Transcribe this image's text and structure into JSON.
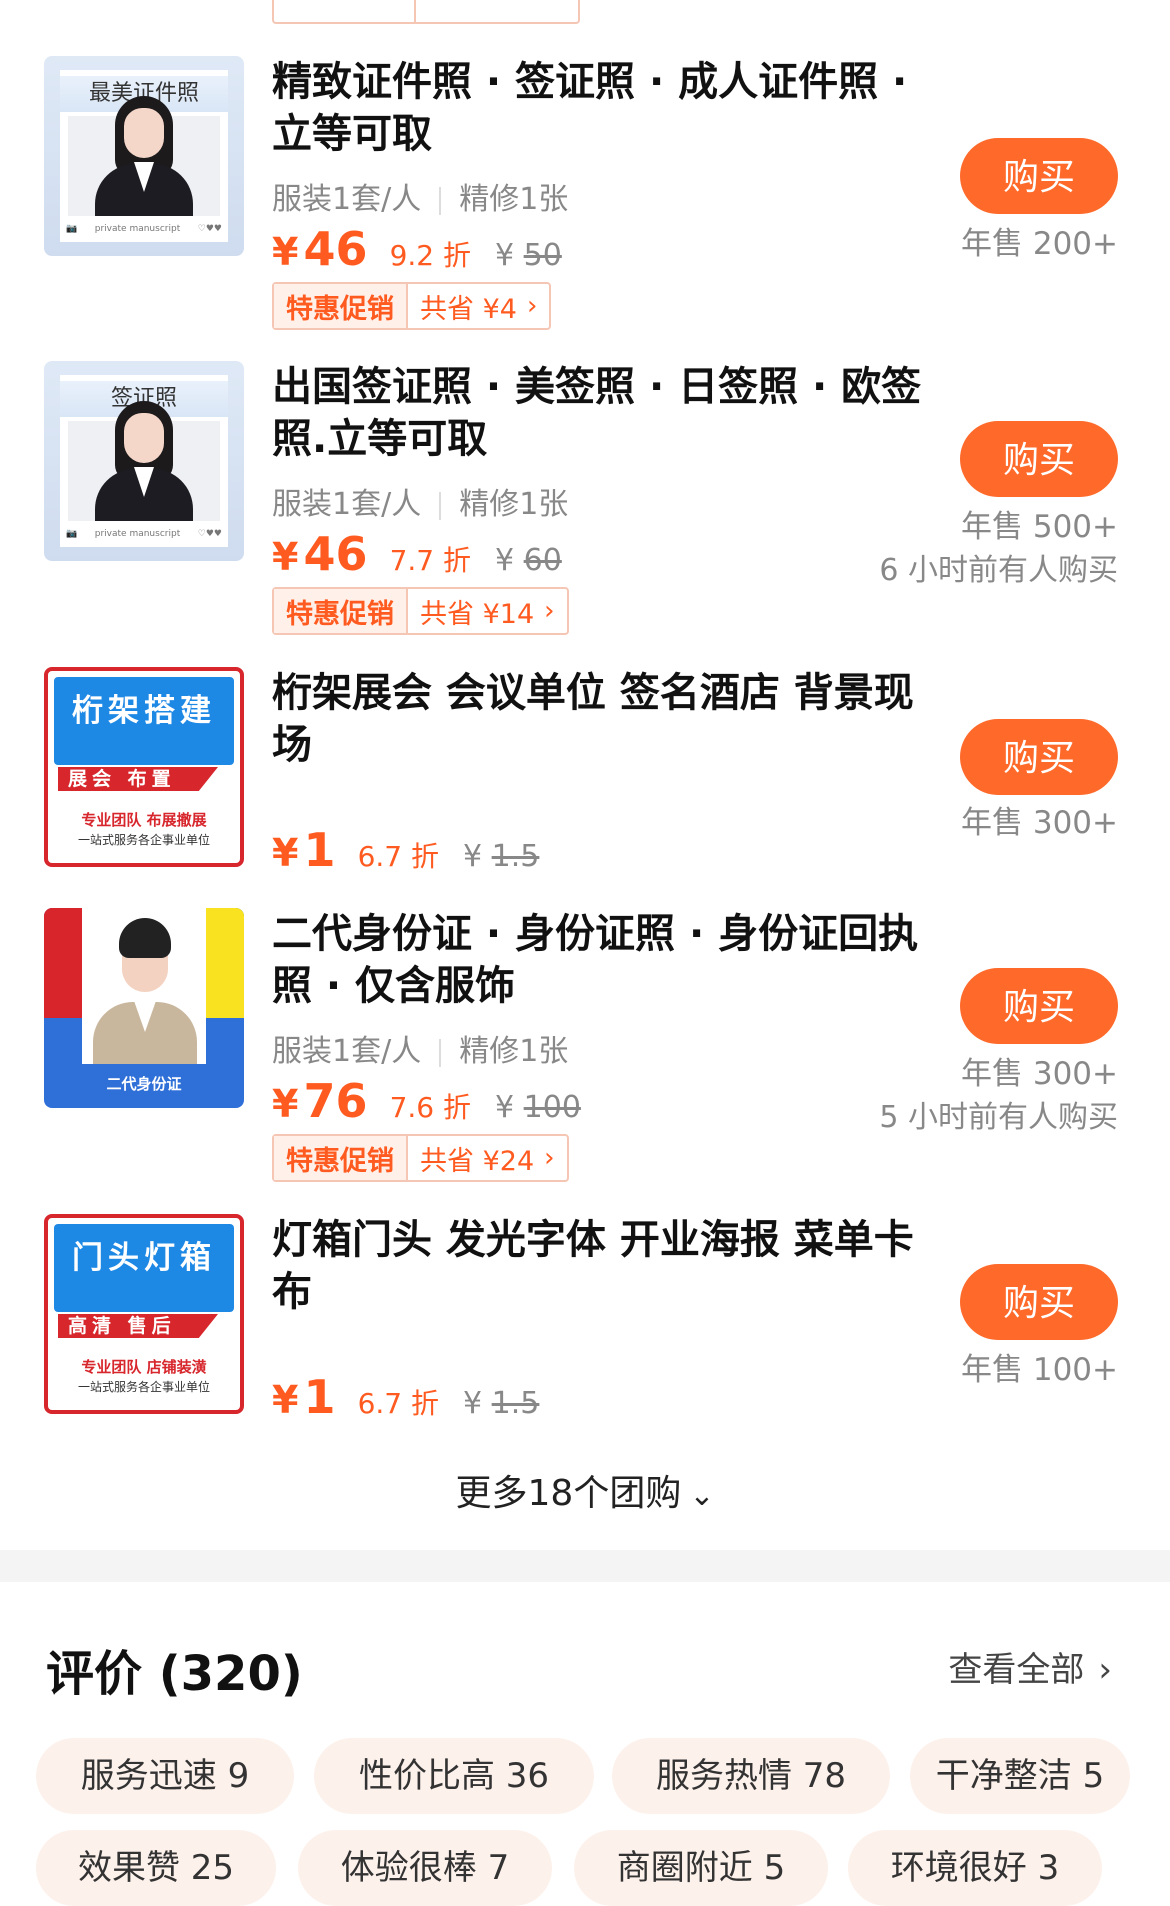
{
  "deals": [
    {
      "title": "精致证件照 · 签证照 · 成人证件照 · 立等可取",
      "spec_outfit": "服装1套/人",
      "spec_retouch": "精修1张",
      "price_symbol": "¥",
      "price": "46",
      "discount": "9.2 折",
      "orig_symbol": "¥",
      "orig_price": "50",
      "promo_label": "特惠促销",
      "promo_save": "共省 ¥4",
      "buy_label": "购买",
      "sales": "年售 200+",
      "thumb_title": "最美证件照",
      "thumb_foot": "private manuscript"
    },
    {
      "title": "出国签证照 · 美签照 · 日签照 · 欧签照.立等可取",
      "spec_outfit": "服装1套/人",
      "spec_retouch": "精修1张",
      "price_symbol": "¥",
      "price": "46",
      "discount": "7.7 折",
      "orig_symbol": "¥",
      "orig_price": "60",
      "promo_label": "特惠促销",
      "promo_save": "共省 ¥14",
      "buy_label": "购买",
      "sales": "年售 500+",
      "recent": "6 小时前有人购买",
      "thumb_title": "签证照",
      "thumb_foot": "private manuscript"
    },
    {
      "title": "桁架展会 会议单位 签名酒店 背景现场",
      "price_symbol": "¥",
      "price": "1",
      "discount": "6.7 折",
      "orig_symbol": "¥",
      "orig_price": "1.5",
      "buy_label": "购买",
      "sales": "年售 300+",
      "poster_title": "桁架搭建",
      "poster_band": "展会 布置",
      "poster_line1": "专业团队 布展撤展",
      "poster_line2": "一站式服务各企事业单位"
    },
    {
      "title": "二代身份证 · 身份证照 · 身份证回执照 · 仅含服饰",
      "spec_outfit": "服装1套/人",
      "spec_retouch": "精修1张",
      "price_symbol": "¥",
      "price": "76",
      "discount": "7.6 折",
      "orig_symbol": "¥",
      "orig_price": "100",
      "promo_label": "特惠促销",
      "promo_save": "共省 ¥24",
      "buy_label": "购买",
      "sales": "年售 300+",
      "recent": "5 小时前有人购买",
      "thumb_label": "二代身份证"
    },
    {
      "title": "灯箱门头  发光字体 开业海报 菜单卡布",
      "price_symbol": "¥",
      "price": "1",
      "discount": "6.7 折",
      "orig_symbol": "¥",
      "orig_price": "1.5",
      "buy_label": "购买",
      "sales": "年售 100+",
      "poster_title": "门头灯箱",
      "poster_band": "高清 售后",
      "poster_line1": "专业团队 店铺装潢",
      "poster_line2": "一站式服务各企事业单位"
    }
  ],
  "more": {
    "label": "更多18个团购"
  },
  "reviews": {
    "title": "评价 (320)",
    "view_all": "查看全部",
    "tags": [
      "服务迅速 9",
      "性价比高 36",
      "服务热情 78",
      "干净整洁 5",
      "效果赞 25",
      "体验很棒 7",
      "商圈附近 5",
      "环境很好 3"
    ]
  },
  "colors": {
    "accent": "#ff5a1f",
    "buy_button": "#ff6a2b",
    "chip_bg": "#fdf1ec"
  }
}
